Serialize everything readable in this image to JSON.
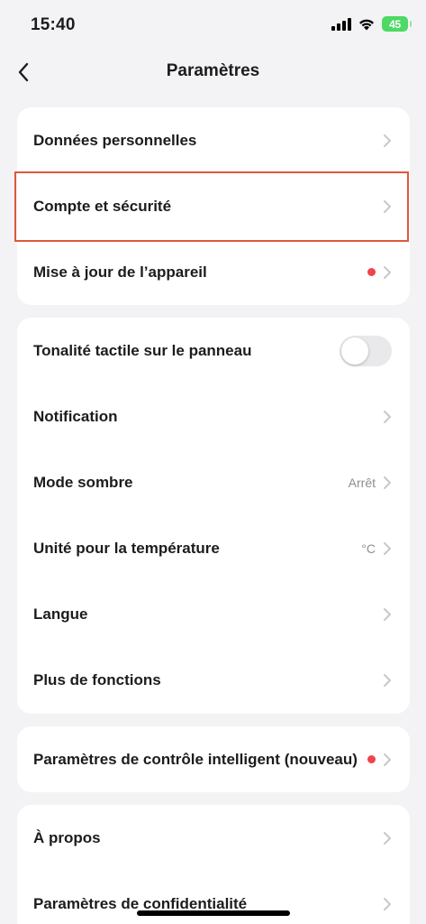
{
  "status_bar": {
    "time": "15:40",
    "battery": "45"
  },
  "nav": {
    "title": "Paramètres",
    "back_icon": "chevron-left-icon"
  },
  "sections": [
    {
      "rows": [
        {
          "label": "Données personnelles"
        },
        {
          "label": "Compte et sécurité",
          "highlighted": true
        },
        {
          "label": "Mise à jour de l’appareil",
          "badge_dot": true
        }
      ]
    },
    {
      "rows": [
        {
          "label": "Tonalité tactile sur le panneau",
          "toggle": false
        },
        {
          "label": "Notification"
        },
        {
          "label": "Mode sombre",
          "value": "Arrêt"
        },
        {
          "label": "Unité pour la température",
          "value": "°C"
        },
        {
          "label": "Langue"
        },
        {
          "label": "Plus de fonctions"
        }
      ]
    },
    {
      "rows": [
        {
          "label": "Paramètres de contrôle intelligent (nouveau)",
          "badge_dot": true
        }
      ]
    },
    {
      "rows": [
        {
          "label": "À propos"
        },
        {
          "label": "Paramètres de confidentialité"
        }
      ]
    }
  ],
  "colors": {
    "background": "#f3f3f5",
    "card": "#ffffff",
    "highlight_border": "#e0583b",
    "badge_dot": "#f0434a",
    "battery": "#4cd964",
    "chevron": "#c7c7cc"
  }
}
